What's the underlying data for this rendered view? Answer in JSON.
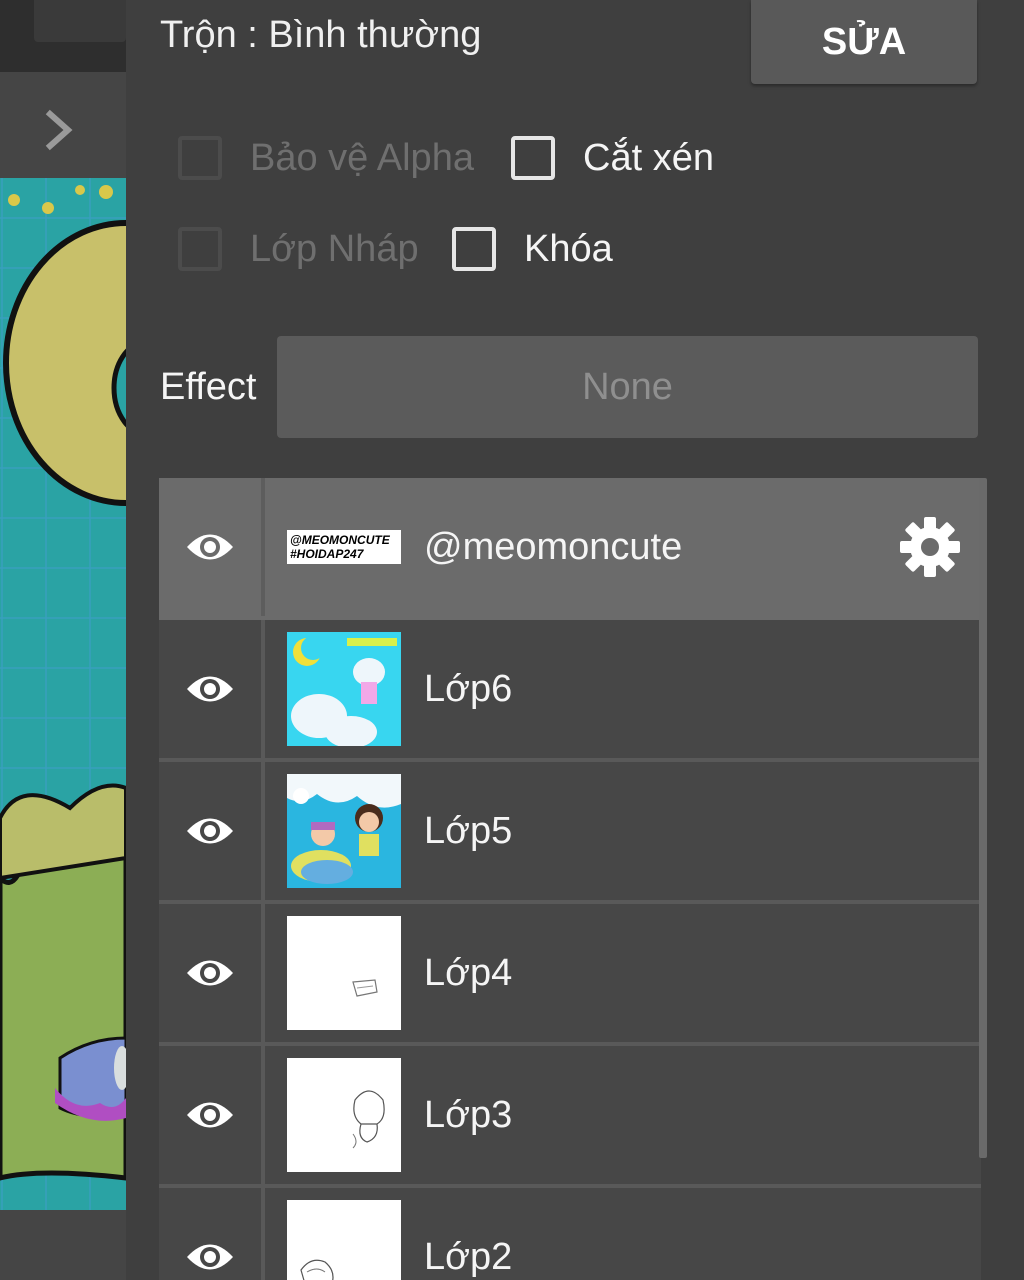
{
  "panel": {
    "blend_label": "Trộn : Bình thường",
    "edit_button": "SỬA",
    "options": {
      "alpha_protect": "Bảo vệ Alpha",
      "clipping": "Cắt xén",
      "draft_layer": "Lớp Nháp",
      "lock": "Khóa"
    },
    "effect_label": "Effect",
    "effect_value": "None"
  },
  "layers": [
    {
      "name": "@meomoncute",
      "thumb_text_1": "@MEOMONCUTE",
      "thumb_text_2": "#HOIDAP247",
      "selected": true
    },
    {
      "name": "Lớp6"
    },
    {
      "name": "Lớp5"
    },
    {
      "name": "Lớp4"
    },
    {
      "name": "Lớp3"
    },
    {
      "name": "Lớp2"
    }
  ],
  "icons": {
    "visibility": "eye-icon",
    "settings": "gear-icon",
    "expand": "chevron-right-icon"
  },
  "colors": {
    "panel_bg": "#3f3f3f",
    "row_bg": "#474747",
    "selected_row_bg": "#6b6b6b",
    "button_bg": "#595959",
    "canvas_teal": "#2aa3a4"
  }
}
